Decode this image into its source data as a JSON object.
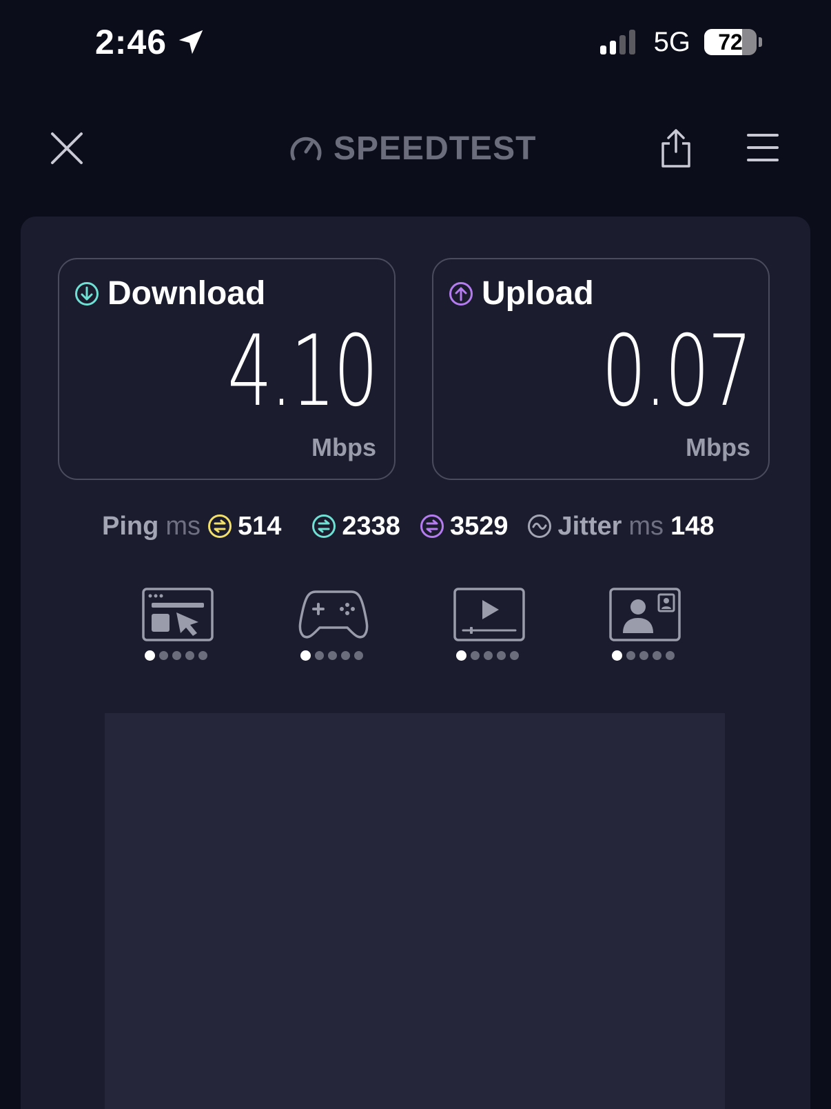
{
  "status_bar": {
    "time": "2:46",
    "network": "5G",
    "battery": "72",
    "battery_level": 0.72,
    "signal_bars_active": 2,
    "signal_bars_total": 4
  },
  "header": {
    "logo_text": "SPEEDTEST",
    "logo_trademark": "·"
  },
  "download": {
    "label": "Download",
    "value": "4.10",
    "unit": "Mbps",
    "color": "#6fe0d4"
  },
  "upload": {
    "label": "Upload",
    "value": "0.07",
    "unit": "Mbps",
    "color": "#b57cf0"
  },
  "ping": {
    "label": "Ping",
    "unit": "ms",
    "idle": "514",
    "download": "2338",
    "upload": "3529",
    "idle_color": "#f2e06a",
    "download_color": "#6fe0d4",
    "upload_color": "#b57cf0"
  },
  "jitter": {
    "label": "Jitter",
    "unit": "ms",
    "value": "148"
  },
  "usecases": [
    {
      "name": "browsing",
      "icon": "browser-cursor-icon",
      "rating": 1,
      "max": 5
    },
    {
      "name": "gaming",
      "icon": "gamepad-icon",
      "rating": 1,
      "max": 5
    },
    {
      "name": "video",
      "icon": "video-play-icon",
      "rating": 1,
      "max": 5
    },
    {
      "name": "video-call",
      "icon": "video-call-icon",
      "rating": 1,
      "max": 5
    }
  ],
  "colors": {
    "background": "#0c0d1a",
    "panel": "#1b1c2e",
    "ad_area": "#25263a"
  }
}
